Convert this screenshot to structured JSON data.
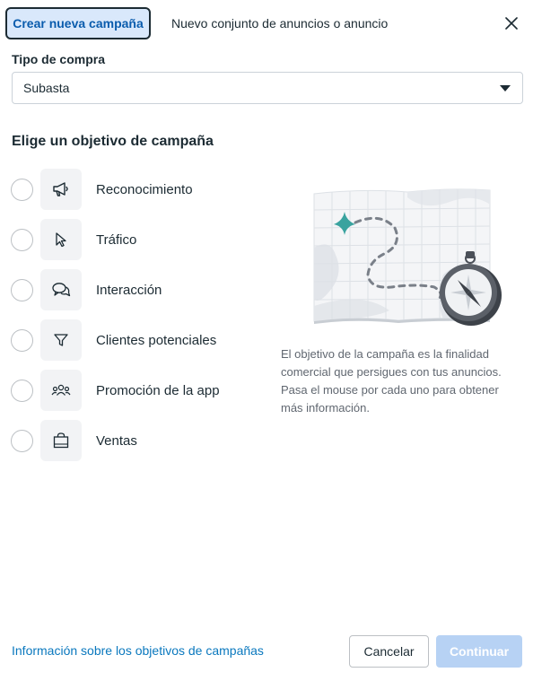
{
  "header": {
    "tabs": [
      {
        "label": "Crear nueva campaña",
        "active": true
      },
      {
        "label": "Nuevo conjunto de anuncios o anuncio",
        "active": false
      }
    ],
    "close_icon": "close-icon"
  },
  "purchase_type": {
    "label": "Tipo de compra",
    "value": "Subasta"
  },
  "objectives_section": {
    "title": "Elige un objetivo de campaña",
    "items": [
      {
        "label": "Reconocimiento",
        "icon": "megaphone-icon",
        "selected": false
      },
      {
        "label": "Tráfico",
        "icon": "cursor-icon",
        "selected": false
      },
      {
        "label": "Interacción",
        "icon": "chat-bubbles-icon",
        "selected": false
      },
      {
        "label": "Clientes potenciales",
        "icon": "funnel-icon",
        "selected": false
      },
      {
        "label": "Promoción de la app",
        "icon": "people-group-icon",
        "selected": false
      },
      {
        "label": "Ventas",
        "icon": "shopping-bag-icon",
        "selected": false
      }
    ]
  },
  "info_panel": {
    "illustration": "map-compass-illustration",
    "description": "El objetivo de la campaña es la finalidad comercial que persigues con tus anuncios. Pasa el mouse por cada uno para obtener más información."
  },
  "footer": {
    "link": "Información sobre los objetivos de campañas",
    "cancel_label": "Cancelar",
    "continue_label": "Continuar",
    "continue_disabled": true
  },
  "colors": {
    "accent_blue": "#0a78be",
    "active_tab_bg": "#d9e8fb",
    "disabled_button_bg": "#b7d2f4",
    "teal_marker": "#3aa39f"
  }
}
